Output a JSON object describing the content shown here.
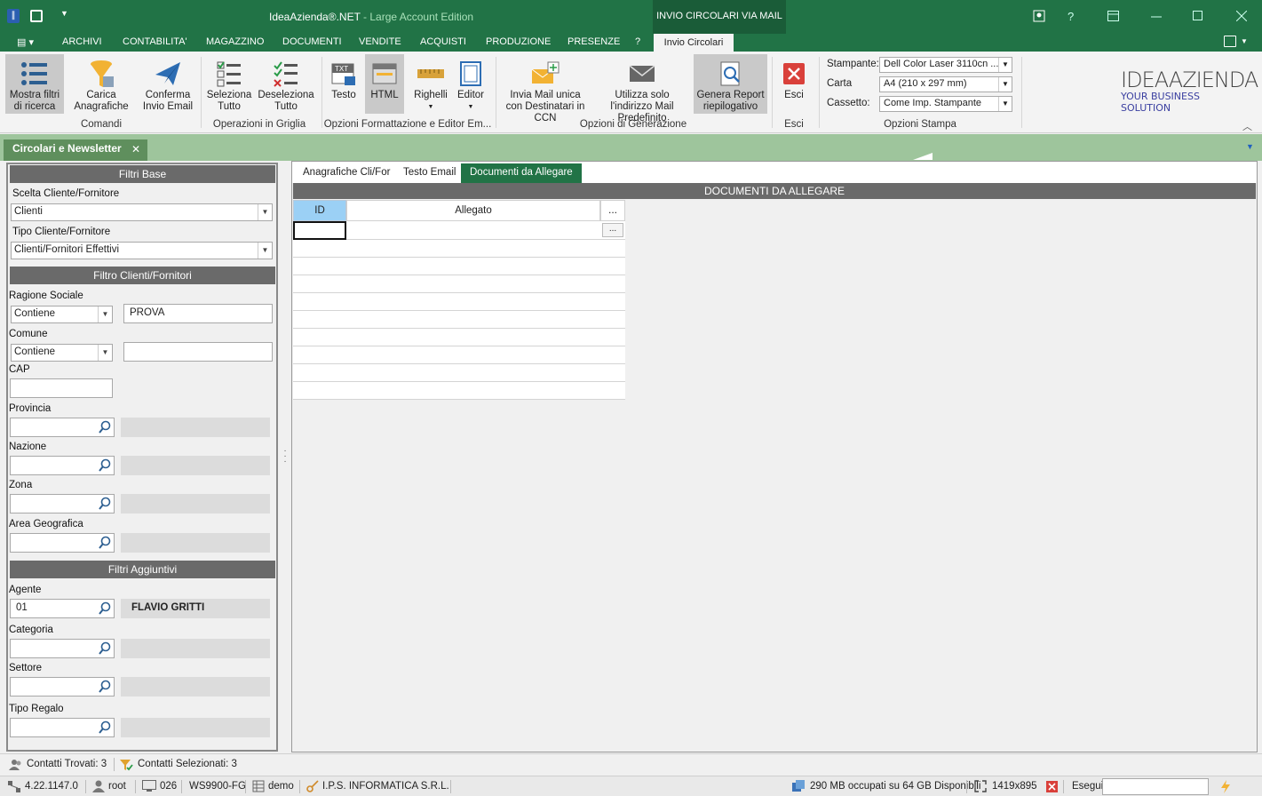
{
  "window": {
    "app_name": "IdeaAzienda®.NET",
    "edition": " - Large Account Edition",
    "context_tab": "INVIO CIRCOLARI VIA MAIL",
    "controls": {
      "help": "?"
    }
  },
  "menu": {
    "items": [
      "ARCHIVI",
      "CONTABILITA'",
      "MAGAZZINO",
      "DOCUMENTI",
      "VENDITE",
      "ACQUISTI",
      "PRODUZIONE",
      "PRESENZE",
      "?"
    ],
    "active": "Invio Circolari"
  },
  "ribbon": {
    "buttons": {
      "mostra_filtri": "Mostra filtri di ricerca",
      "carica": "Carica Anagrafiche",
      "conferma": "Conferma Invio Email",
      "seleziona": "Seleziona Tutto",
      "deseleziona": "Deseleziona Tutto",
      "testo": "Testo",
      "html": "HTML",
      "righelli": "Righelli",
      "editor": "Editor",
      "invia_ccn": "Invia Mail unica con Destinatari in CCN",
      "utilizza": "Utilizza solo l'indirizzo Mail Predefinito",
      "genera_report": "Genera Report riepilogativo",
      "esci": "Esci"
    },
    "groups": {
      "comandi": "Comandi",
      "operazioni": "Operazioni in Griglia",
      "opzioni_form": "Opzioni Formattazione e Editor Em...",
      "opzioni_gen": "Opzioni di Generazione",
      "esci": "Esci",
      "stampa": "Opzioni Stampa"
    },
    "print": {
      "stampante_label": "Stampante:",
      "stampante_value": "Dell Color Laser 3110cn ...",
      "carta_label": "Carta",
      "carta_value": "A4 (210 x 297 mm)",
      "cassetto_label": "Cassetto:",
      "cassetto_value": "Come Imp. Stampante"
    },
    "logo": {
      "line1": "IDEAAZIENDA",
      "line2": "YOUR BUSINESS SOLUTION"
    }
  },
  "doc_tab": {
    "title": "Circolari e Newsletter",
    "close": "✕"
  },
  "filters": {
    "base_title": "Filtri Base",
    "scelta_label": "Scelta Cliente/Fornitore",
    "scelta_value": "Clienti",
    "tipo_label": "Tipo Cliente/Fornitore",
    "tipo_value": "Clienti/Fornitori Effettivi",
    "clienti_title": "Filtro Clienti/Fornitori",
    "ragione_label": "Ragione Sociale",
    "ragione_op": "Contiene",
    "ragione_value": "PROVA",
    "comune_label": "Comune",
    "comune_op": "Contiene",
    "comune_value": "",
    "cap_label": "CAP",
    "provincia_label": "Provincia",
    "nazione_label": "Nazione",
    "zona_label": "Zona",
    "area_label": "Area Geografica",
    "aggiuntivi_title": "Filtri Aggiuntivi",
    "agente_label": "Agente",
    "agente_code": "01",
    "agente_name": "FLAVIO GRITTI",
    "categoria_label": "Categoria",
    "settore_label": "Settore",
    "regalo_label": "Tipo Regalo"
  },
  "tabs": [
    "Anagrafiche Cli/For",
    "Testo Email",
    "Documenti da Allegare"
  ],
  "grid": {
    "title": "DOCUMENTI DA ALLEGARE",
    "col_id": "ID",
    "col_allegato": "Allegato",
    "col_btn": "...",
    "row_btn": "..."
  },
  "status": {
    "trovati": "Contatti Trovati: 3",
    "selezionati": "Contatti Selezionati: 3",
    "version": "4.22.1147.0",
    "user": "root",
    "terminal": "026",
    "workstation": "WS9900-FG",
    "db": "demo",
    "company": "I.P.S. INFORMATICA S.R.L.",
    "memory": "290 MB occupati su 64 GB Disponibili",
    "resolution": "1419x895",
    "esegui": "Esegui"
  },
  "colors": {
    "accent": "#217346",
    "doc_tab_bar": "#9ec59c",
    "section_header": "#6a6a6a"
  }
}
